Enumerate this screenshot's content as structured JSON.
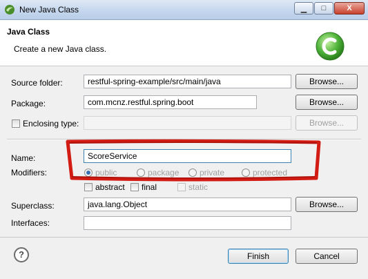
{
  "window": {
    "title": "New Java Class",
    "minimize_glyph": "▁",
    "maximize_glyph": "□",
    "close_glyph": "X"
  },
  "header": {
    "title": "Java Class",
    "description": "Create a new Java class."
  },
  "form": {
    "source_folder_label": "Source folder:",
    "source_folder_value": "restful-spring-example/src/main/java",
    "package_label": "Package:",
    "package_value": "com.mcnz.restful.spring.boot",
    "enclosing_type_label": "Enclosing type:",
    "enclosing_type_value": "",
    "name_label": "Name:",
    "name_value": "ScoreService",
    "modifiers_label": "Modifiers:",
    "modifier_options": [
      "public",
      "package",
      "private",
      "protected"
    ],
    "modifier_selected": "public",
    "extra_modifiers": [
      "abstract",
      "final",
      "static"
    ],
    "superclass_label": "Superclass:",
    "superclass_value": "java.lang.Object",
    "interfaces_label": "Interfaces:",
    "interfaces_value": ""
  },
  "buttons": {
    "browse": "Browse...",
    "finish": "Finish",
    "cancel": "Cancel",
    "help": "?"
  },
  "colors": {
    "annotation": "#d21b12",
    "accent_green": "#3aa536"
  },
  "icons": [
    "eclipse-icon",
    "class-wizard-icon",
    "help-icon"
  ]
}
